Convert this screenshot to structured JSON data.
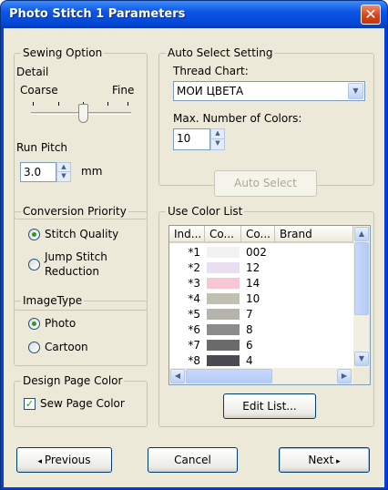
{
  "window": {
    "title": "Photo Stitch 1 Parameters"
  },
  "sewing_option": {
    "title": "Sewing Option",
    "detail_label": "Detail",
    "coarse_label": "Coarse",
    "fine_label": "Fine",
    "run_pitch_label": "Run Pitch",
    "run_pitch_value": "3.0",
    "unit": "mm"
  },
  "conversion_priority": {
    "title": "Conversion Priority",
    "options": [
      {
        "label": "Stitch Quality",
        "selected": true
      },
      {
        "label": "Jump Stitch",
        "label2": "Reduction",
        "selected": false
      }
    ]
  },
  "image_type": {
    "title": "ImageType",
    "options": [
      {
        "label": "Photo",
        "selected": true
      },
      {
        "label": "Cartoon",
        "selected": false
      }
    ]
  },
  "design_page_color": {
    "title": "Design Page Color",
    "checkbox_label": "Sew Page Color",
    "checked": true
  },
  "auto_select": {
    "title": "Auto Select Setting",
    "thread_chart_label": "Thread Chart:",
    "thread_chart_value": "МОИ ЦВЕТА",
    "max_colors_label": "Max. Number of Colors:",
    "max_colors_value": "10",
    "button": "Auto Select"
  },
  "color_list": {
    "title": "Use Color List",
    "headers": [
      "Ind...",
      "Co...",
      "Co...",
      "Brand"
    ],
    "rows": [
      {
        "index": "*1",
        "color": "#f2f2f2",
        "code": "002"
      },
      {
        "index": "*2",
        "color": "#eadff0",
        "code": "12"
      },
      {
        "index": "*3",
        "color": "#f7c8d4",
        "code": "14"
      },
      {
        "index": "*4",
        "color": "#c1c1b1",
        "code": "10"
      },
      {
        "index": "*5",
        "color": "#b4b4ac",
        "code": "7"
      },
      {
        "index": "*6",
        "color": "#8c8c8c",
        "code": "8"
      },
      {
        "index": "*7",
        "color": "#6a6a6a",
        "code": "6"
      },
      {
        "index": "*8",
        "color": "#4a4a52",
        "code": "4"
      }
    ],
    "edit_button": "Edit List..."
  },
  "footer": {
    "previous": "Previous",
    "cancel": "Cancel",
    "next": "Next"
  }
}
